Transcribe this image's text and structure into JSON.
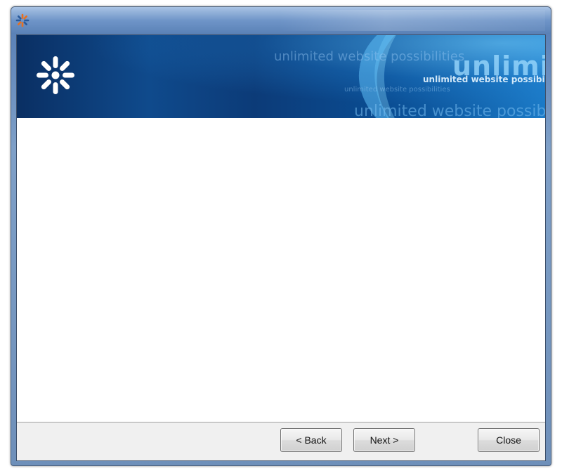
{
  "window": {
    "title": ""
  },
  "banner": {
    "taglines": [
      "unlimited website possibilities",
      "unlimit",
      "unlimited website possibilities",
      "unlimited website possibilities",
      "unlimited website possibilities"
    ]
  },
  "footer": {
    "back_label": "< Back",
    "next_label": "Next >",
    "close_label": "Close"
  },
  "colors": {
    "banner_dark": "#0a2f63",
    "banner_light": "#1b7ac7",
    "logo": "#ffffff",
    "app_icon_orange": "#e8701e",
    "app_icon_blue": "#2a5a9a"
  },
  "icons": {
    "app_icon": "kaltura-icon",
    "banner_logo": "kaltura-logo"
  }
}
